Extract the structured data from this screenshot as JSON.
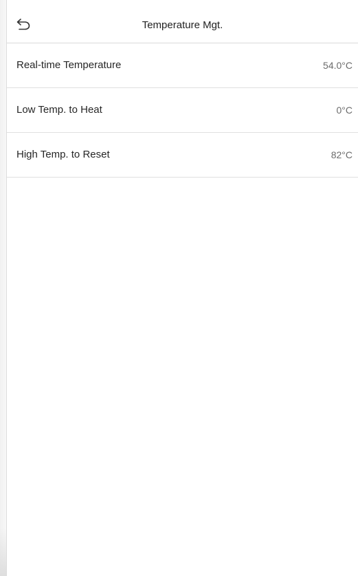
{
  "header": {
    "back_icon": "back-arrow-icon",
    "title": "Temperature Mgt."
  },
  "settings": [
    {
      "label": "Real-time Temperature",
      "value": "54.0°C"
    },
    {
      "label": "Low Temp. to Heat",
      "value": "0°C"
    },
    {
      "label": "High Temp. to Reset",
      "value": "82°C"
    }
  ],
  "colors": {
    "background": "#ffffff",
    "text": "#262626",
    "value_text": "#6b6b6b",
    "divider": "#e0e0e0"
  }
}
